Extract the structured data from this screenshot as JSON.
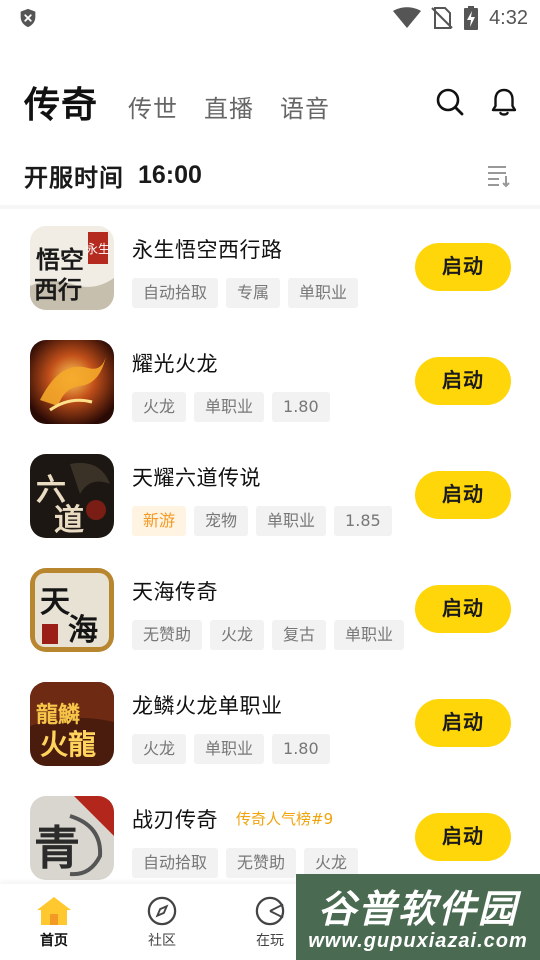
{
  "status_bar": {
    "time": "4:32",
    "icons": [
      "shield-icon",
      "wifi-icon",
      "no-sim-icon",
      "battery-charging-icon"
    ]
  },
  "header": {
    "active_tab": "传奇",
    "tabs": [
      "传世",
      "直播",
      "语音"
    ],
    "actions": [
      "search-icon",
      "bell-icon"
    ]
  },
  "server": {
    "label": "开服时间",
    "time": "16:00",
    "sort_icon": "sort-list-icon"
  },
  "launch_label": "启动",
  "games": [
    {
      "name": "永生悟空西行路",
      "tags": [
        "自动拾取",
        "专属",
        "单职业"
      ],
      "icon_text": "悟空西行路"
    },
    {
      "name": "耀光火龙",
      "tags": [
        "火龙",
        "单职业",
        "1.80"
      ],
      "icon_text": ""
    },
    {
      "name": "天耀六道传说",
      "tags": [
        "新游",
        "宠物",
        "单职业",
        "1.85"
      ],
      "icon_text": "六道"
    },
    {
      "name": "天海传奇",
      "tags": [
        "无赞助",
        "火龙",
        "复古",
        "单职业"
      ],
      "icon_text": "天海"
    },
    {
      "name": "龙鳞火龙单职业",
      "tags": [
        "火龙",
        "单职业",
        "1.80"
      ],
      "icon_text": "火龍"
    },
    {
      "name": "战刃传奇",
      "badge": "传奇人气榜#9",
      "tags": [
        "自动拾取",
        "无赞助",
        "火龙"
      ],
      "icon_text": "青"
    }
  ],
  "bottom_nav": [
    {
      "label": "首页",
      "icon": "home-icon",
      "active": true
    },
    {
      "label": "社区",
      "icon": "compass-icon",
      "active": false
    },
    {
      "label": "在玩",
      "icon": "gamepad-icon",
      "active": false
    }
  ],
  "watermark": {
    "title": "谷普软件园",
    "url": "www.gupuxiazai.com"
  },
  "colors": {
    "accent": "#ffd60a",
    "new_tag_text": "#f39a26",
    "rank_badge": "#f0a30a",
    "tag_bg": "#f2f2f2"
  }
}
